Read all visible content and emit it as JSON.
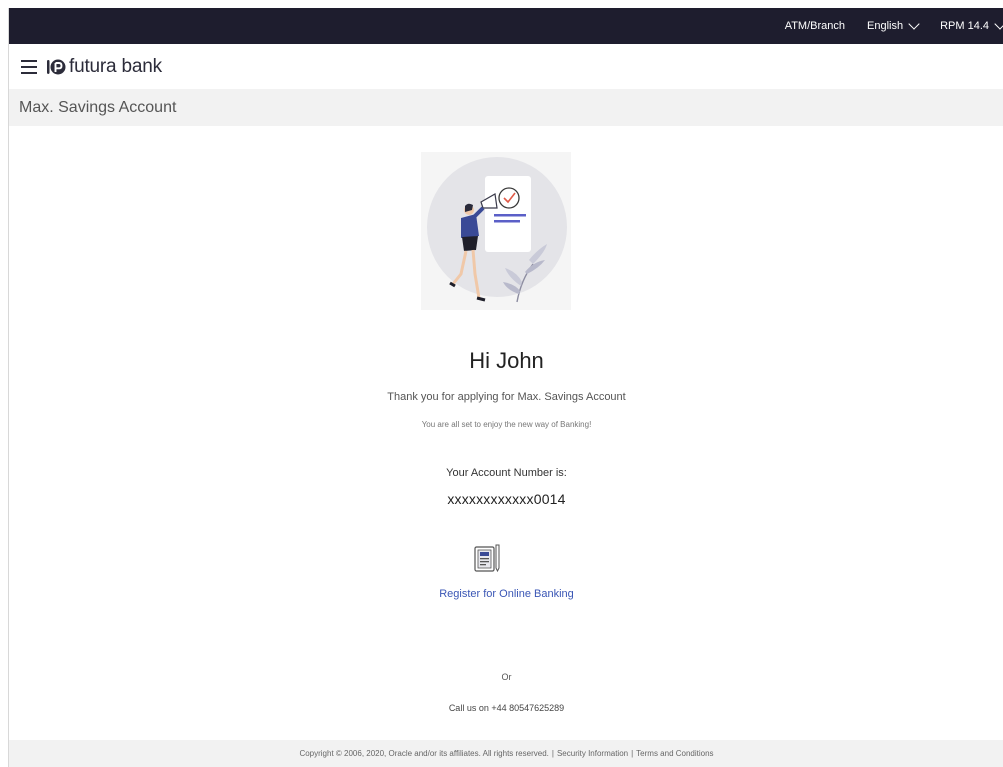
{
  "topbar": {
    "atm_branch": "ATM/Branch",
    "language": "English",
    "user": "RPM 14.4"
  },
  "header": {
    "logo_text": "futura bank"
  },
  "page": {
    "title": "Max. Savings Account"
  },
  "confirmation": {
    "greeting": "Hi John",
    "thanks": "Thank you for applying for Max. Savings Account",
    "subtext": "You are all set to enjoy the new way of Banking!",
    "account_label": "Your Account Number is:",
    "account_number": "xxxxxxxxxxxx0014",
    "register_link": "Register for Online Banking",
    "or_text": "Or",
    "call_text": "Call us on +44 80547625289"
  },
  "footer": {
    "copyright": "Copyright © 2006, 2020, Oracle and/or its affiliates. All rights reserved.",
    "security": "Security Information",
    "terms": "Terms and Conditions"
  },
  "colors": {
    "topbar_bg": "#1e1d2e",
    "link": "#3a56b5",
    "accent_purple": "#5b5fc7",
    "check_red": "#e05a47"
  }
}
